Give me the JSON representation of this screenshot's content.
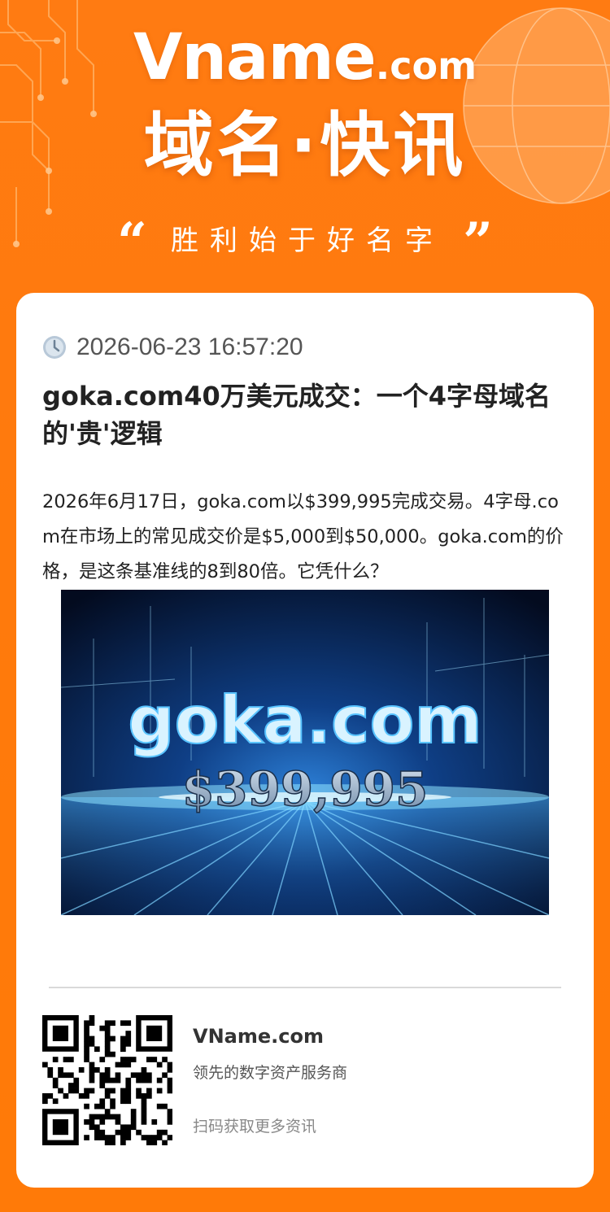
{
  "header": {
    "logo_main": "Vname",
    "logo_suffix": ".com",
    "headline": "域名·快讯",
    "open_quote": "“",
    "slogan": "胜利始于好名字",
    "close_quote": "”"
  },
  "article": {
    "timestamp": "2026-06-23 16:57:20",
    "title": "goka.com40万美元成交：一个4字母域名的'贵'逻辑",
    "summary": "2026年6月17日，goka.com以$399,995完成交易。4字母.com在市场上的常见成交价是$5,000到$50,000。goka.com的价格，是这条基准线的8到80倍。它凭什么？",
    "image": {
      "domain_text": "goka.com",
      "price_text": "$399,995"
    }
  },
  "footer": {
    "brand": "VName.com",
    "description": "领先的数字资产服务商",
    "scan_tip": "扫码获取更多资讯"
  },
  "icons": {
    "clock": "clock-icon",
    "qr": "qr-code"
  },
  "colors": {
    "background": "#ff7a0c",
    "card": "#ffffff",
    "title_text": "#222222",
    "image_glow": "#7fd3ff"
  }
}
